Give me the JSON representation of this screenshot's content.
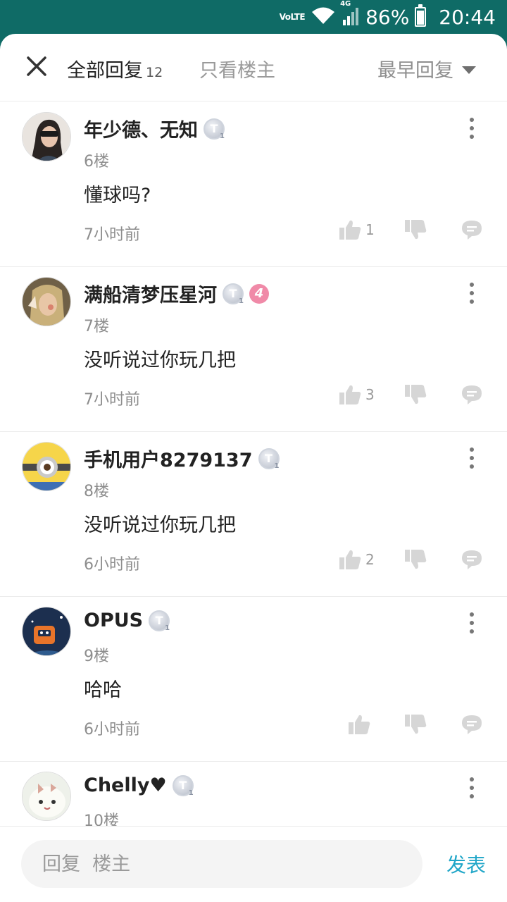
{
  "status_bar": {
    "network": "VoLTE",
    "signal_type": "4G",
    "battery": "86%",
    "time": "20:44"
  },
  "header": {
    "tab_all_label": "全部回复",
    "tab_all_count": "12",
    "tab_owner_label": "只看楼主",
    "sort_label": "最早回复"
  },
  "comments": [
    {
      "username": "年少德、无知",
      "badge": "T",
      "floor": "6楼",
      "content": "懂球吗?",
      "time": "7小时前",
      "likes": "1"
    },
    {
      "username": "满船清梦压星河",
      "badge": "T",
      "level": "4",
      "floor": "7楼",
      "content": "没听说过你玩几把",
      "time": "7小时前",
      "likes": "3"
    },
    {
      "username": "手机用户8279137",
      "badge": "T",
      "floor": "8楼",
      "content": "没听说过你玩几把",
      "time": "6小时前",
      "likes": "2"
    },
    {
      "username": "OPUS",
      "badge": "T",
      "floor": "9楼",
      "content": "哈哈",
      "time": "6小时前",
      "likes": ""
    },
    {
      "username": "Chelly♥",
      "badge": "T",
      "floor": "10楼",
      "content": "",
      "time": "",
      "likes": ""
    }
  ],
  "bottom_bar": {
    "placeholder": "回复  楼主",
    "post_label": "发表"
  },
  "colors": {
    "status_bar": "#0f6b66",
    "accent": "#20a6c8",
    "level_badge": "#f08aa8"
  }
}
